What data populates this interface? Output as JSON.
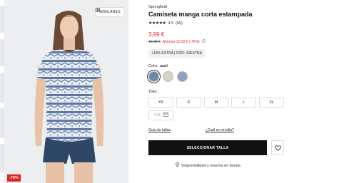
{
  "gallery": {
    "similar_label": "SIMILARES",
    "discount_badge": "-75%"
  },
  "product": {
    "brand": "Springfield",
    "title": "Camiseta manga corta estampada",
    "rating_value": "4.5",
    "rating_count": "(60)",
    "stars_filled": 4.5,
    "price": "3,99 €",
    "old_price": "15,99 €",
    "saving": "Ahorras 12,00 € (-75%)",
    "promo_code": "+10% EXTRA | CÓD: 10EXTRA"
  },
  "color": {
    "label": "Color:",
    "selected": "azul",
    "swatches": [
      {
        "name": "azul",
        "hex": "#6f86a8"
      },
      {
        "name": "beige",
        "hex": "#d8d2c4"
      },
      {
        "name": "azul claro",
        "hex": "#8fa0c0"
      }
    ]
  },
  "size": {
    "label": "Talla:",
    "options": [
      "XS",
      "S",
      "M",
      "L",
      "XL"
    ],
    "unavailable": "XXL"
  },
  "links": {
    "size_guide": "Guía de tallas",
    "my_size": "¿Cuál es mi talla?"
  },
  "actions": {
    "select_size": "SELECCIONAR TALLA",
    "availability": "Disponibilidad y reserva en tienda"
  },
  "colors": {
    "sale": "#dd2222",
    "cta": "#111111"
  }
}
